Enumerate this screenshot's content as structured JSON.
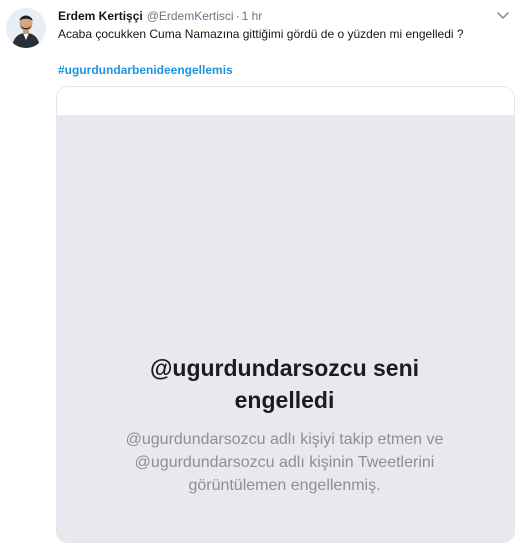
{
  "tweet": {
    "author_name": "Erdem Kertişçi",
    "handle": "@ErdemKertisci",
    "separator": "·",
    "time": "1 hr",
    "text": "Acaba çocukken Cuma Namazına gittiğimi gördü de o yüzden mi engelledi ?",
    "hashtag": "#ugurdundarbenideengellemis"
  },
  "media": {
    "title_line1": "@ugurdundarsozcu seni",
    "title_line2": "engelledi",
    "desc_line1": "@ugurdundarsozcu adlı kişiyi takip etmen ve",
    "desc_line2": "@ugurdundarsozcu adlı kişinin Tweetlerini",
    "desc_line3": "görüntülemen engellenmiş."
  },
  "icons": {
    "more": "chevron-down-icon",
    "avatar": "avatar"
  },
  "colors": {
    "link": "#1b95e0",
    "secondary": "#657786",
    "image_bg": "#e9e8ee"
  }
}
